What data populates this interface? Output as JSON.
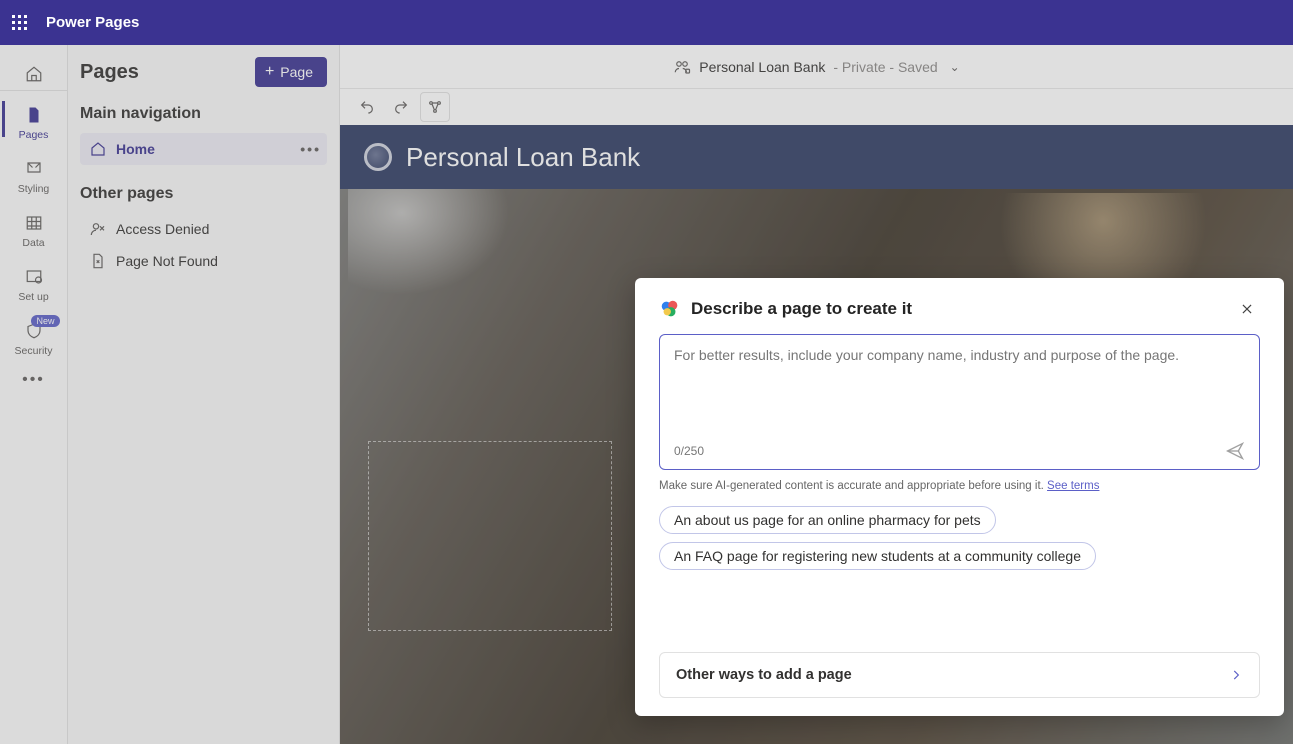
{
  "app": {
    "title": "Power Pages"
  },
  "rail": {
    "items": [
      {
        "label": "Pages"
      },
      {
        "label": "Styling"
      },
      {
        "label": "Data"
      },
      {
        "label": "Set up"
      },
      {
        "label": "Security",
        "badge": "New"
      }
    ]
  },
  "leftPanel": {
    "title": "Pages",
    "addButton": "Page",
    "mainNavLabel": "Main navigation",
    "homeLabel": "Home",
    "otherLabel": "Other pages",
    "otherItems": [
      {
        "label": "Access Denied"
      },
      {
        "label": "Page Not Found"
      }
    ]
  },
  "crumb": {
    "siteName": "Personal Loan Bank",
    "status": " - Private - Saved"
  },
  "site": {
    "bannerTitle": "Personal Loan Bank"
  },
  "copilot": {
    "title": "Describe a page to create it",
    "placeholder": "For better results, include your company name, industry and purpose of the page.",
    "counter": "0/250",
    "disclaimerPrefix": "Make sure AI-generated content is accurate and appropriate before using it. ",
    "disclaimerLink": "See terms",
    "suggestions": [
      "An about us page for an online pharmacy for pets",
      "An FAQ page for registering new students at a community college"
    ],
    "otherWays": "Other ways to add a page"
  }
}
